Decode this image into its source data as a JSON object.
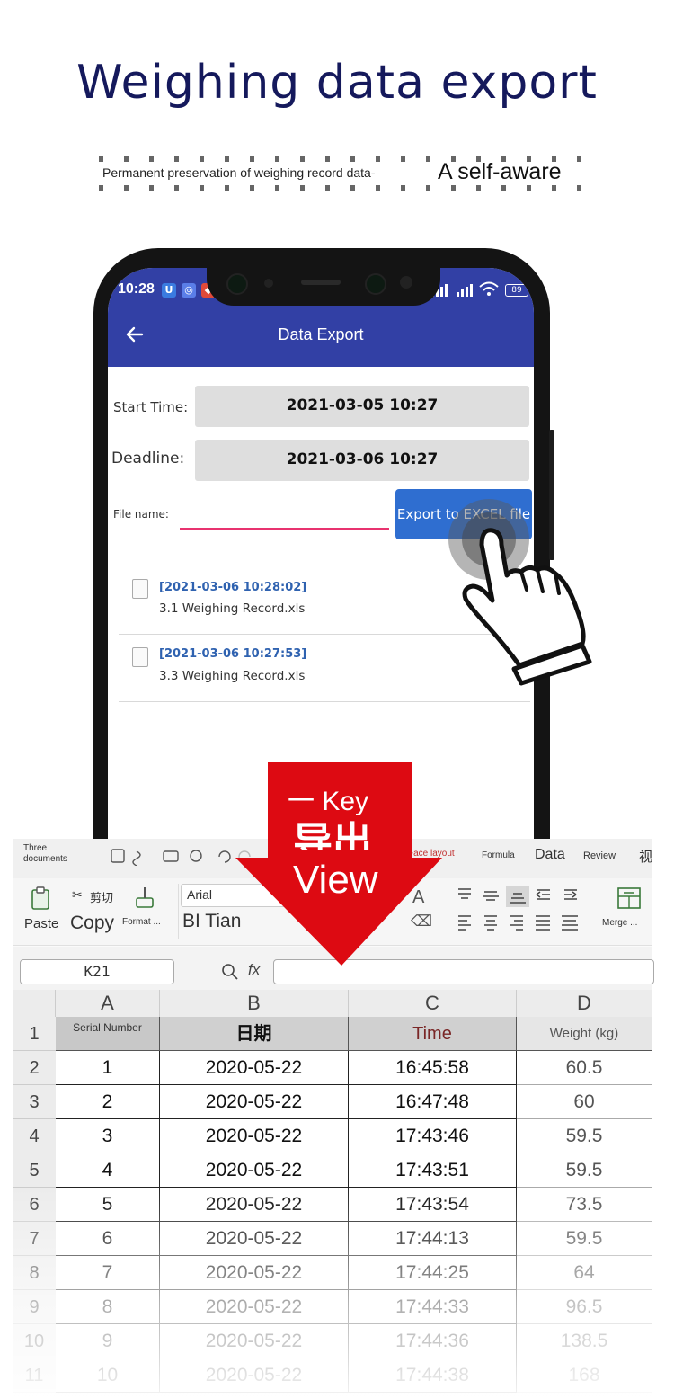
{
  "header": {
    "title": "Weighing data export",
    "subtitle_left": "Permanent preservation of weighing record data-",
    "subtitle_right": "A self-aware"
  },
  "phone": {
    "status": {
      "time": "10:28",
      "battery": "89"
    },
    "app_title": "Data Export",
    "start_label": "Start Time:",
    "start_value": "2021-03-05 10:27",
    "deadline_label": "Deadline:",
    "deadline_value": "2021-03-06 10:27",
    "filename_label": "File name:",
    "filename_value": "",
    "export_button": "Export to EXCEL file",
    "records": [
      {
        "date": "[2021-03-06 10:28:02]",
        "name": "3.1 Weighing Record.xls"
      },
      {
        "date": "[2021-03-06 10:27:53]",
        "name": "3.3 Weighing Record.xls"
      }
    ]
  },
  "arrow": {
    "line1": "一 Key",
    "line2": "导出",
    "line3": "View"
  },
  "excel": {
    "menu": {
      "documents": "Three\ndocuments",
      "face_layout": "Face layout",
      "formula": "Formula",
      "data": "Data",
      "review": "Review",
      "view": "视"
    },
    "toolbar": {
      "paste": "Paste",
      "cut": "剪切",
      "copy": "Copy",
      "format": "Format ...",
      "font_name": "Arial",
      "font_display": "BI Tian",
      "font_size_up": "A",
      "merge": "Merge ..."
    },
    "namebox": "K21",
    "fx": "fx",
    "columns": [
      "A",
      "B",
      "C",
      "D"
    ],
    "headers": [
      "Serial Number",
      "日期",
      "Time",
      "Weight (kg)"
    ],
    "rows": [
      {
        "n": "2",
        "a": "1",
        "b": "2020-05-22",
        "c": "16:45:58",
        "d": "60.5"
      },
      {
        "n": "3",
        "a": "2",
        "b": "2020-05-22",
        "c": "16:47:48",
        "d": "60"
      },
      {
        "n": "4",
        "a": "3",
        "b": "2020-05-22",
        "c": "17:43:46",
        "d": "59.5"
      },
      {
        "n": "5",
        "a": "4",
        "b": "2020-05-22",
        "c": "17:43:51",
        "d": "59.5"
      },
      {
        "n": "6",
        "a": "5",
        "b": "2020-05-22",
        "c": "17:43:54",
        "d": "73.5"
      },
      {
        "n": "7",
        "a": "6",
        "b": "2020-05-22",
        "c": "17:44:13",
        "d": "59.5"
      },
      {
        "n": "8",
        "a": "7",
        "b": "2020-05-22",
        "c": "17:44:25",
        "d": "64"
      },
      {
        "n": "9",
        "a": "8",
        "b": "2020-05-22",
        "c": "17:44:33",
        "d": "96.5"
      },
      {
        "n": "10",
        "a": "9",
        "b": "2020-05-22",
        "c": "17:44:36",
        "d": "138.5"
      },
      {
        "n": "11",
        "a": "10",
        "b": "2020-05-22",
        "c": "17:44:38",
        "d": "168"
      }
    ],
    "header_row_number": "1"
  }
}
